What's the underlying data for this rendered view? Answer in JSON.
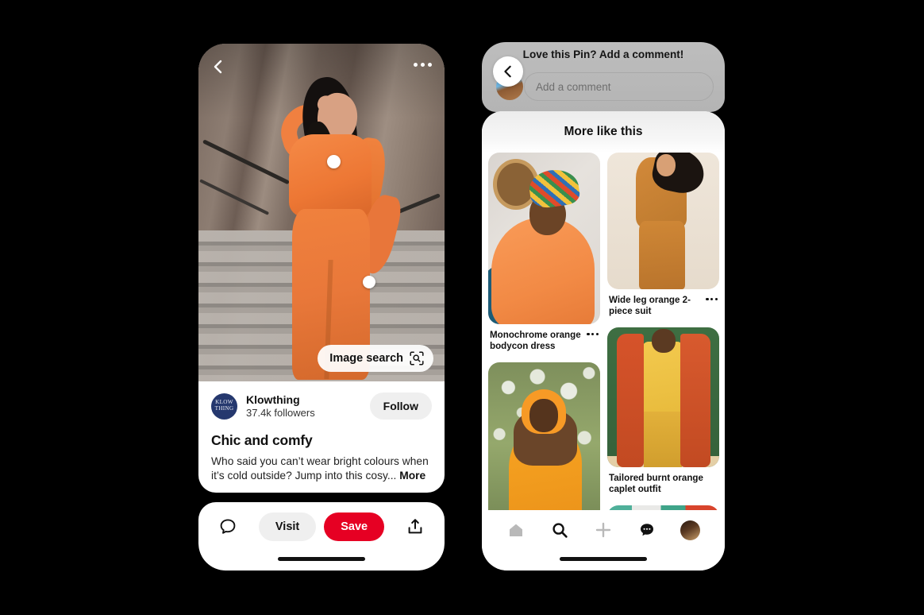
{
  "left_phone": {
    "pin": {
      "back_icon": "chevron-left-icon",
      "more_icon": "overflow-dots-icon",
      "image_search_label": "Image search",
      "image_search_icon": "lens-scan-icon",
      "product_dots": [
        "product-tag-dot-1",
        "product-tag-dot-2"
      ]
    },
    "creator": {
      "logo_line1": "KLOW",
      "logo_line2": "THING",
      "name": "Klowthing",
      "followers": "37.4k followers",
      "follow_label": "Follow"
    },
    "title": "Chic and comfy",
    "description": "Who said you can’t wear bright colours when it’s cold outside? Jump into this cosy...",
    "more_label": "More",
    "actions": {
      "comment_icon": "speech-bubble-icon",
      "visit_label": "Visit",
      "save_label": "Save",
      "share_icon": "share-upload-icon",
      "save_color": "#e60023"
    }
  },
  "right_phone": {
    "comment_bar": {
      "prompt": "Love this Pin? Add a comment!",
      "placeholder": "Add a comment",
      "back_icon": "chevron-left-icon",
      "avatar": "user-avatar"
    },
    "feed": {
      "header": "More like this",
      "items": [
        {
          "caption": "Monochrome orange bodycon dress",
          "menu_icon": "overflow-dots-icon"
        },
        {
          "caption": "Wide leg orange 2-piece suit",
          "menu_icon": "overflow-dots-icon"
        },
        {
          "caption": "",
          "menu_icon": ""
        },
        {
          "caption": "Tailored burnt orange caplet outfit",
          "menu_icon": "overflow-dots-icon"
        }
      ]
    },
    "tabbar": {
      "items": [
        {
          "icon": "home-icon",
          "active": false
        },
        {
          "icon": "search-icon",
          "active": true
        },
        {
          "icon": "plus-icon",
          "active": false
        },
        {
          "icon": "chat-bubble-icon",
          "active": true
        },
        {
          "icon": "profile-avatar-icon",
          "active": false
        }
      ]
    }
  }
}
